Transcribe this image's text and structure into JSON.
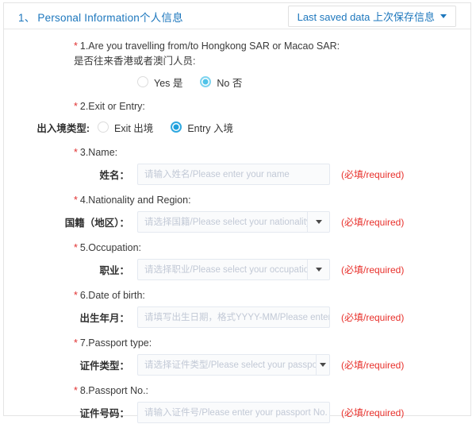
{
  "header": {
    "section_number": "1、",
    "title": "Personal Information个人信息",
    "saved_button_label": "Last saved data 上次保存信息",
    "caret_icon": "chevron-down-icon",
    "accent_color": "#1d77bd"
  },
  "required_marker": "*",
  "required_note": "(必填/required)",
  "questions": [
    {
      "id": "q1",
      "en_label": "1.Are you travelling from/to Hongkong SAR or Macao SAR:",
      "cn_label": "是否往来香港或者澳门人员:",
      "type": "radio",
      "options": [
        {
          "label": "Yes 是",
          "selected": false
        },
        {
          "label": "No 否",
          "selected": true
        }
      ]
    },
    {
      "id": "q2",
      "en_label": "2.Exit or Entry:",
      "cn_label": "出入境类型:",
      "type": "radio-inline",
      "options": [
        {
          "label": "Exit 出境",
          "selected": false
        },
        {
          "label": "Entry 入境",
          "selected": true
        }
      ]
    },
    {
      "id": "q3",
      "en_label": "3.Name:",
      "row_label": "姓名：",
      "type": "text",
      "value": "",
      "placeholder": "请输入姓名/Please enter your name",
      "required_note": "(必填/required)"
    },
    {
      "id": "q4",
      "en_label": "4.Nationality and Region:",
      "row_label": "国籍（地区）：",
      "type": "select",
      "value": "",
      "placeholder": "请选择国籍/Please select your nationality",
      "required_note": "(必填/required)"
    },
    {
      "id": "q5",
      "en_label": "5.Occupation:",
      "row_label": "职业：",
      "type": "select",
      "value": "",
      "placeholder": "请选择职业/Please select your occupation",
      "required_note": "(必填/required)"
    },
    {
      "id": "q6",
      "en_label": "6.Date of birth:",
      "row_label": "出生年月：",
      "type": "text",
      "value": "",
      "placeholder": "请填写出生日期，格式YYYY-MM/Please enter your date of birth",
      "required_note": "(必填/required)"
    },
    {
      "id": "q7",
      "en_label": "7.Passport type:",
      "row_label": "证件类型：",
      "type": "select",
      "value": "",
      "placeholder": "请选择证件类型/Please select your passport type",
      "required_note": "(必填/required)"
    },
    {
      "id": "q8",
      "en_label": "8.Passport No.:",
      "row_label": "证件号码：",
      "type": "text",
      "value": "",
      "placeholder": "请输入证件号/Please enter your passport No.",
      "required_note": "(必填/required)"
    }
  ]
}
